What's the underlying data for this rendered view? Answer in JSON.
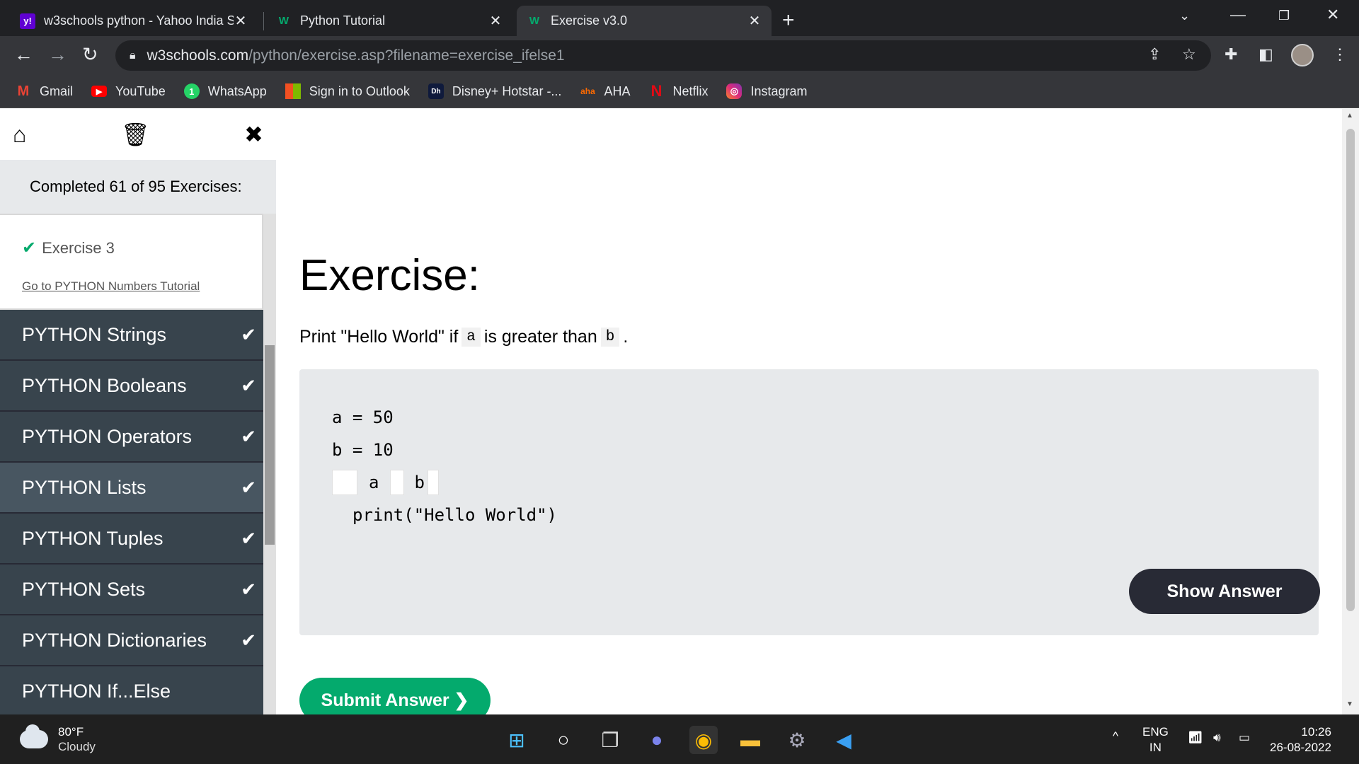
{
  "tabs": [
    {
      "favicon": "y!",
      "title": "w3schools python - Yahoo India Search",
      "active": false
    },
    {
      "favicon": "W",
      "title": "Python Tutorial",
      "active": false
    },
    {
      "favicon": "W",
      "title": "Exercise v3.0",
      "active": true
    }
  ],
  "address": {
    "host": "w3schools.com",
    "path": "/python/exercise.asp?filename=exercise_ifelse1"
  },
  "bookmarks": [
    {
      "label": "Gmail",
      "icon": "gmail-icon"
    },
    {
      "label": "YouTube",
      "icon": "youtube-icon"
    },
    {
      "label": "WhatsApp",
      "icon": "whatsapp-icon"
    },
    {
      "label": "Sign in to Outlook",
      "icon": "microsoft-icon"
    },
    {
      "label": "Disney+ Hotstar -...",
      "icon": "hotstar-icon"
    },
    {
      "label": "AHA",
      "icon": "aha-icon"
    },
    {
      "label": "Netflix",
      "icon": "netflix-icon"
    },
    {
      "label": "Instagram",
      "icon": "instagram-icon"
    }
  ],
  "sidebar": {
    "completed_text": "Completed 61 of 95 Exercises:",
    "exercise_item": "Exercise 3",
    "tutorial_link": "Go to PYTHON Numbers Tutorial",
    "topics": [
      {
        "label": "PYTHON Strings"
      },
      {
        "label": "PYTHON Booleans"
      },
      {
        "label": "PYTHON Operators"
      },
      {
        "label": "PYTHON Lists"
      },
      {
        "label": "PYTHON Tuples"
      },
      {
        "label": "PYTHON Sets"
      },
      {
        "label": "PYTHON Dictionaries"
      },
      {
        "label": "PYTHON If...Else"
      }
    ]
  },
  "main": {
    "heading": "Exercise:",
    "prompt_before": "Print \"Hello World\" if",
    "prompt_var_a": "a",
    "prompt_middle": "is greater than",
    "prompt_var_b": "b",
    "prompt_end": ".",
    "code": {
      "line1": "a = 50",
      "line2": "b = 10",
      "line3_a": "a",
      "line3_b": "b",
      "line4": "print(\"Hello World\")"
    },
    "show_answer": "Show Answer",
    "submit": "Submit Answer ❯"
  },
  "taskbar": {
    "temperature": "80°F",
    "condition": "Cloudy",
    "lang1": "ENG",
    "lang2": "IN",
    "time": "10:26",
    "date": "26-08-2022"
  },
  "colors": {
    "accent_green": "#04aa6d",
    "sidebar_topic": "#38444d",
    "dark_button": "#282a35"
  }
}
